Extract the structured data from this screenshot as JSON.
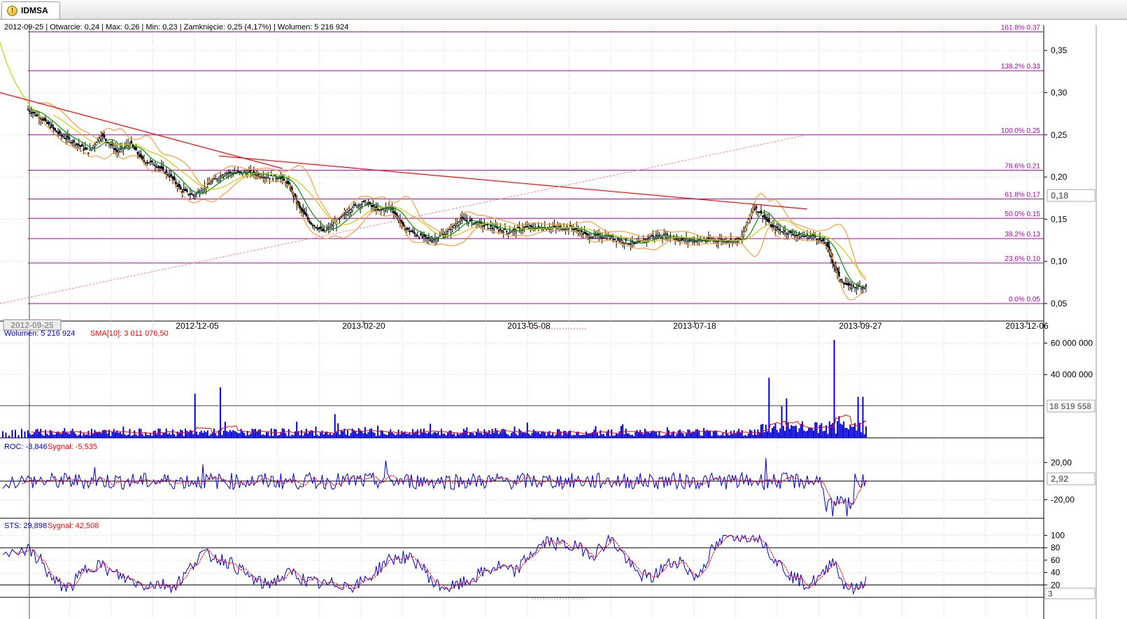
{
  "window": {
    "tab_label": "IDMSA",
    "icon": "warning-icon"
  },
  "info_line": "2012-09-25 | Otwarcie: 0,24 | Max: 0,26 | Min: 0,23 | Zamknięcie: 0,25 (4,17%)  | Wolumen: 5 216 924",
  "colors": {
    "candle": "#000000",
    "fib": "#b000b0",
    "trend": "#ff0000",
    "bollinger": "#ff9933",
    "sma_short": "#009900",
    "sma_long": "#cccc00",
    "volume": "#0000dd",
    "signal": "#ff0000"
  },
  "chart_data": [
    {
      "type": "candlestick",
      "panel": "price",
      "x_axis_labels": [
        "2012-09-25",
        "2012-12-05",
        "2013-02-20",
        "2013-05-08",
        "2013-07-18",
        "2013-09-27",
        "2013-12-06"
      ],
      "y_ticks": [
        "0,35",
        "0,30",
        "0,25",
        "0,20",
        "0,15",
        "0,10",
        "0,05"
      ],
      "ylim": [
        0.04,
        0.38
      ],
      "current_value_label": "0,18",
      "fibonacci_levels": [
        {
          "label": "161.8% 0.37",
          "value": 0.372
        },
        {
          "label": "138.2% 0.33",
          "value": 0.326
        },
        {
          "label": "100.0% 0.25",
          "value": 0.25
        },
        {
          "label": "78.6% 0.21",
          "value": 0.208
        },
        {
          "label": "61.8% 0.17",
          "value": 0.174
        },
        {
          "label": "50.0% 0.15",
          "value": 0.151
        },
        {
          "label": "38.2% 0.13",
          "value": 0.127
        },
        {
          "label": "23.6% 0.10",
          "value": 0.098
        },
        {
          "label": "0.0% 0.05",
          "value": 0.05
        }
      ],
      "close_path": [
        [
          0,
          0.28
        ],
        [
          8,
          0.27
        ],
        [
          20,
          0.25
        ],
        [
          30,
          0.24
        ],
        [
          38,
          0.23
        ],
        [
          46,
          0.25
        ],
        [
          56,
          0.23
        ],
        [
          64,
          0.24
        ],
        [
          72,
          0.22
        ],
        [
          80,
          0.215
        ],
        [
          90,
          0.2
        ],
        [
          96,
          0.185
        ],
        [
          104,
          0.178
        ],
        [
          116,
          0.195
        ],
        [
          124,
          0.205
        ],
        [
          132,
          0.205
        ],
        [
          140,
          0.205
        ],
        [
          150,
          0.2
        ],
        [
          158,
          0.2
        ],
        [
          164,
          0.19
        ],
        [
          170,
          0.165
        ],
        [
          178,
          0.145
        ],
        [
          186,
          0.135
        ],
        [
          196,
          0.15
        ],
        [
          204,
          0.165
        ],
        [
          212,
          0.17
        ],
        [
          220,
          0.16
        ],
        [
          228,
          0.165
        ],
        [
          236,
          0.14
        ],
        [
          246,
          0.13
        ],
        [
          254,
          0.125
        ],
        [
          264,
          0.135
        ],
        [
          272,
          0.15
        ],
        [
          282,
          0.145
        ],
        [
          292,
          0.14
        ],
        [
          302,
          0.135
        ],
        [
          312,
          0.14
        ],
        [
          322,
          0.14
        ],
        [
          332,
          0.14
        ],
        [
          342,
          0.14
        ],
        [
          352,
          0.13
        ],
        [
          362,
          0.13
        ],
        [
          372,
          0.125
        ],
        [
          382,
          0.12
        ],
        [
          392,
          0.13
        ],
        [
          402,
          0.13
        ],
        [
          412,
          0.125
        ],
        [
          422,
          0.125
        ],
        [
          432,
          0.125
        ],
        [
          448,
          0.125
        ],
        [
          456,
          0.165
        ],
        [
          462,
          0.155
        ],
        [
          468,
          0.14
        ],
        [
          476,
          0.135
        ],
        [
          486,
          0.13
        ],
        [
          494,
          0.13
        ],
        [
          502,
          0.12
        ],
        [
          510,
          0.08
        ],
        [
          516,
          0.07
        ],
        [
          522,
          0.07
        ],
        [
          527,
          0.07
        ],
        [
          532,
          0.075
        ]
      ],
      "trendlines": [
        {
          "from": [
            0,
            0.3
          ],
          "to": [
            160,
            0.21
          ]
        },
        {
          "from": [
            120,
            0.225
          ],
          "to": [
            490,
            0.162
          ]
        },
        {
          "from": [
            0,
            0.05
          ],
          "to": [
            490,
            0.25
          ],
          "style": "dashed"
        }
      ]
    },
    {
      "type": "bar",
      "panel": "volume",
      "legend": [
        {
          "label": "Wolumen: 5 216 924",
          "color": "#0000dd"
        },
        {
          "label": "SMA[10]: 3 011 076,50",
          "color": "#ff0000"
        }
      ],
      "y_ticks": [
        "60 000 000",
        "40 000 000"
      ],
      "ylim": [
        0,
        62000000
      ],
      "current_value_label": "18 519 558",
      "spikes": [
        [
          105,
          28000000
        ],
        [
          121,
          32000000
        ],
        [
          193,
          15000000
        ],
        [
          466,
          38000000
        ],
        [
          474,
          20000000
        ],
        [
          477,
          25000000
        ],
        [
          507,
          62000000
        ],
        [
          522,
          26000000
        ],
        [
          525,
          26000000
        ]
      ],
      "baseline": 3500000
    },
    {
      "type": "line",
      "panel": "roc",
      "legend": [
        {
          "label": "ROC: -3,846",
          "color": "#0000dd"
        },
        {
          "label": "Sygnał: -5,535",
          "color": "#ff0000"
        }
      ],
      "y_ticks": [
        "20,00",
        "-20,00"
      ],
      "ylim": [
        -40,
        30
      ],
      "current_value_label": "2,92",
      "roc_extremes": [
        [
          42,
          15
        ],
        [
          110,
          18
        ],
        [
          225,
          22
        ],
        [
          464,
          25
        ],
        [
          506,
          -38
        ],
        [
          515,
          -38
        ],
        [
          521,
          1
        ],
        [
          527,
          1
        ]
      ]
    },
    {
      "type": "line",
      "panel": "sts",
      "legend": [
        {
          "label": "STS: 29,898",
          "color": "#0000dd"
        },
        {
          "label": "Sygnał: 42,508",
          "color": "#ff0000"
        }
      ],
      "y_ticks": [
        "100",
        "80",
        "60",
        "40",
        "20"
      ],
      "ylim": [
        0,
        105
      ],
      "current_value_label": "3",
      "sts_path": [
        [
          0,
          75
        ],
        [
          8,
          60
        ],
        [
          16,
          25
        ],
        [
          26,
          15
        ],
        [
          36,
          45
        ],
        [
          44,
          55
        ],
        [
          52,
          40
        ],
        [
          62,
          30
        ],
        [
          72,
          20
        ],
        [
          82,
          22
        ],
        [
          92,
          18
        ],
        [
          100,
          40
        ],
        [
          108,
          70
        ],
        [
          118,
          65
        ],
        [
          128,
          55
        ],
        [
          138,
          35
        ],
        [
          148,
          20
        ],
        [
          158,
          30
        ],
        [
          166,
          40
        ],
        [
          176,
          25
        ],
        [
          186,
          20
        ],
        [
          196,
          22
        ],
        [
          206,
          18
        ],
        [
          216,
          35
        ],
        [
          226,
          60
        ],
        [
          236,
          65
        ],
        [
          246,
          55
        ],
        [
          256,
          20
        ],
        [
          266,
          15
        ],
        [
          276,
          25
        ],
        [
          286,
          40
        ],
        [
          296,
          50
        ],
        [
          306,
          40
        ],
        [
          316,
          70
        ],
        [
          326,
          90
        ],
        [
          336,
          85
        ],
        [
          346,
          80
        ],
        [
          356,
          70
        ],
        [
          366,
          95
        ],
        [
          374,
          70
        ],
        [
          382,
          40
        ],
        [
          392,
          30
        ],
        [
          400,
          50
        ],
        [
          410,
          60
        ],
        [
          420,
          30
        ],
        [
          430,
          75
        ],
        [
          440,
          100
        ],
        [
          450,
          100
        ],
        [
          460,
          100
        ],
        [
          470,
          60
        ],
        [
          480,
          35
        ],
        [
          490,
          20
        ],
        [
          500,
          35
        ],
        [
          506,
          65
        ],
        [
          512,
          25
        ],
        [
          520,
          10
        ],
        [
          527,
          30
        ]
      ]
    }
  ]
}
